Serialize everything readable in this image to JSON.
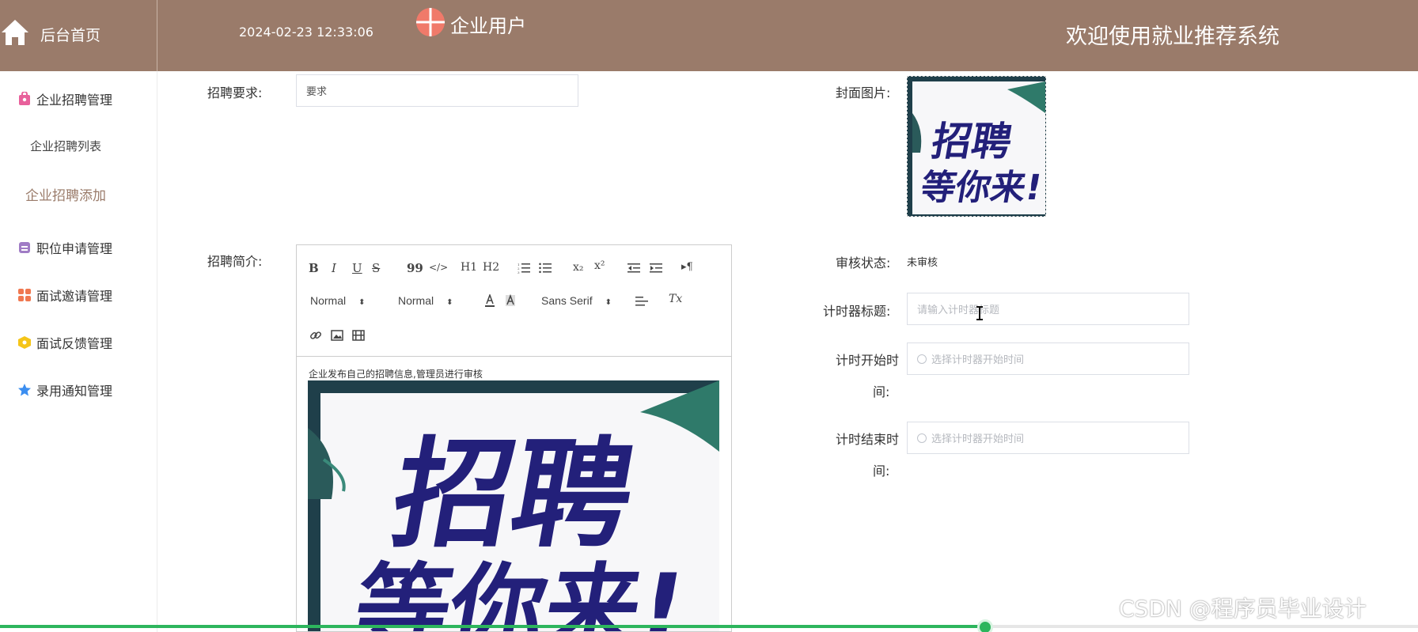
{
  "header": {
    "home_label": "后台首页",
    "datetime": "2024-02-23 12:33:06",
    "user_label": "企业用户",
    "welcome": "欢迎使用就业推荐系统",
    "bg_color": "#9a7b6a"
  },
  "sidebar": {
    "groups": [
      {
        "label": "企业招聘管理",
        "icon": "bag-icon",
        "color": "#e8609b"
      },
      {
        "label": "职位申请管理",
        "icon": "briefcase-icon",
        "color": "#a07cc5"
      },
      {
        "label": "面试邀请管理",
        "icon": "grid-icon",
        "color": "#f07850"
      },
      {
        "label": "面试反馈管理",
        "icon": "cube-icon",
        "color": "#f5c518"
      },
      {
        "label": "录用通知管理",
        "icon": "star-icon",
        "color": "#3b8ef0"
      }
    ],
    "sub_items": [
      {
        "label": "企业招聘列表",
        "active": false
      },
      {
        "label": "企业招聘添加",
        "active": true
      }
    ]
  },
  "form": {
    "requirement_label": "招聘要求:",
    "requirement_value": "要求",
    "intro_label": "招聘简介:",
    "cover_label": "封面图片:",
    "status_label": "审核状态:",
    "status_value": "未审核",
    "timer_title_label": "计时器标题:",
    "timer_title_placeholder": "请输入计时器标题",
    "timer_start_label_1": "计时开始时",
    "timer_start_label_2": "间:",
    "timer_start_placeholder": "选择计时器开始时间",
    "timer_end_label_1": "计时结束时",
    "timer_end_label_2": "间:",
    "timer_end_placeholder": "选择计时器开始时间"
  },
  "editor": {
    "toolbar": {
      "bold": "B",
      "italic": "I",
      "underline": "U",
      "strike": "S",
      "quote": "99",
      "code": "</>",
      "h1": "H1",
      "h2": "H2",
      "sub": "x₂",
      "sup": "x²",
      "rtl": "▸¶",
      "size": "Normal",
      "header": "Normal",
      "font": "Sans Serif",
      "clean": "Tx"
    },
    "content_text": "企业发布自己的招聘信息,管理员进行审核"
  },
  "poster": {
    "line1": "招聘",
    "line2": "等你来!"
  },
  "watermark": "CSDN @程序员毕业设计",
  "video_progress": 0.695
}
